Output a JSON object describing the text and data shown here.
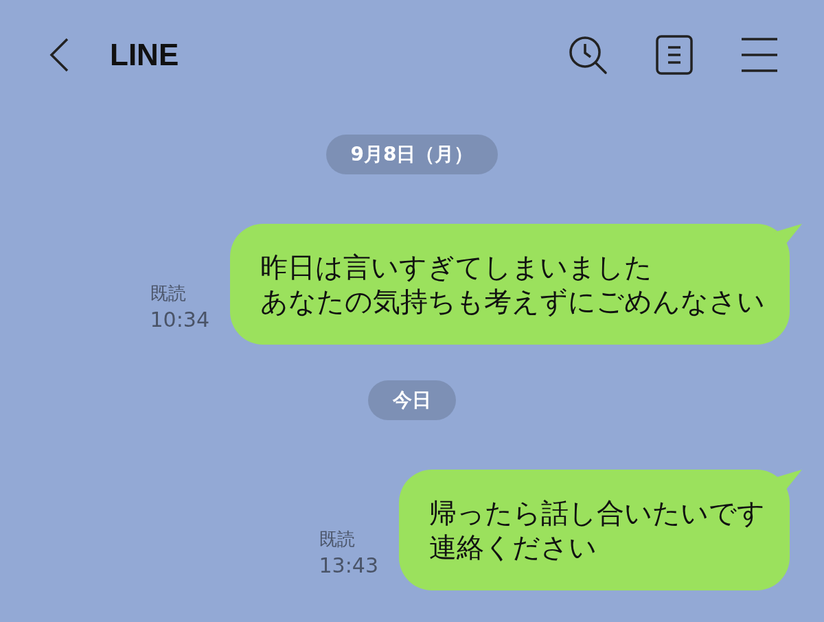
{
  "header": {
    "title": "LINE"
  },
  "items": [
    {
      "kind": "date",
      "label": "9月8日（月）"
    },
    {
      "kind": "message",
      "read": "既読",
      "time": "10:34",
      "lines": [
        "昨日は言いすぎてしまいました",
        "あなたの気持ちも考えずにごめんなさい"
      ]
    },
    {
      "kind": "date",
      "label": "今日"
    },
    {
      "kind": "message",
      "read": "既読",
      "time": "13:43",
      "lines": [
        "帰ったら話し合いたいです",
        "連絡ください"
      ]
    }
  ]
}
